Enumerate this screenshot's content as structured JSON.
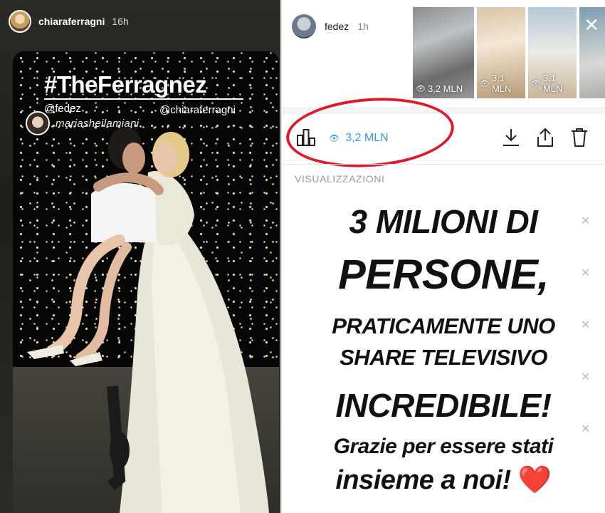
{
  "left_story": {
    "username": "chiaraferragni",
    "time": "16h",
    "tag_mention": "mariasheilamiani",
    "hashtag": "#TheFerragnez",
    "mention_1": "@fedez",
    "mention_2": "@chiaraferragni"
  },
  "right_story": {
    "username": "fedez",
    "time": "1h",
    "thumbnails": [
      {
        "views": "3,2 MLN",
        "selected": true
      },
      {
        "views": "3,1 MLN",
        "selected": false
      },
      {
        "views": "3,1 MLN",
        "selected": false
      },
      {
        "views": "",
        "selected": false
      }
    ],
    "views_label": "3,2 MLN",
    "section_label": "VISUALIZZAZIONI",
    "message": {
      "line1": "3 MILIONI DI",
      "line2": "PERSONE,",
      "line3": "PRATICAMENTE UNO",
      "line4": "SHARE TELEVISIVO",
      "line5": "INCREDIBILE!",
      "line6": "Grazie per essere stati",
      "line7": "insieme a noi!",
      "heart": "❤️"
    }
  },
  "colors": {
    "accent_blue": "#3897f0",
    "annotation_red": "#e0192a"
  }
}
